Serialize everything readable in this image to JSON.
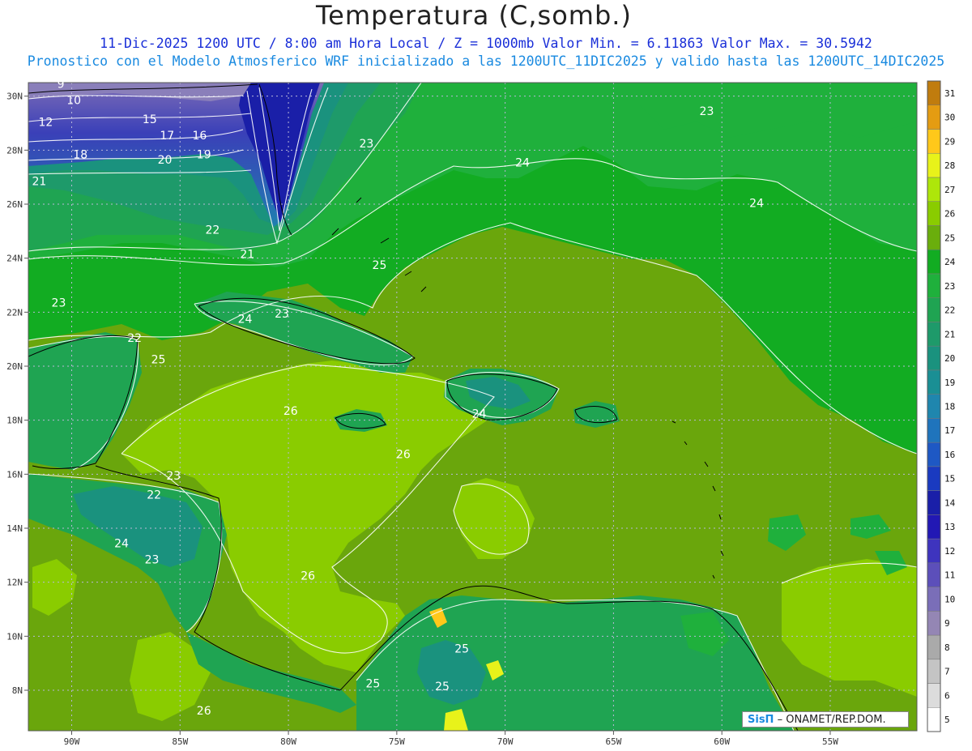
{
  "header": {
    "title": "Temperatura (C,somb.)",
    "line1": "11-Dic-2025  1200 UTC / 8:00 am Hora Local / Z = 1000mb   Valor Min. = 6.11863  Valor Max. = 30.5942",
    "line2": "Pronostico con el Modelo Atmosferico WRF inicializado a las 1200UTC_11DIC2025 y valido hasta las  1200UTC_14DIC2025"
  },
  "map": {
    "lon_range": [
      -92,
      -51
    ],
    "lat_range": [
      6.5,
      30.5
    ],
    "lon_ticks": [
      -90,
      -85,
      -80,
      -75,
      -70,
      -65,
      -60,
      -55
    ],
    "lon_tick_labels": [
      "90W",
      "85W",
      "80W",
      "75W",
      "70W",
      "65W",
      "60W",
      "55W"
    ],
    "lat_ticks": [
      8,
      10,
      12,
      14,
      16,
      18,
      20,
      22,
      24,
      26,
      28,
      30
    ],
    "lat_tick_labels": [
      "8N",
      "10N",
      "12N",
      "14N",
      "16N",
      "18N",
      "20N",
      "22N",
      "24N",
      "26N",
      "28N",
      "30N"
    ],
    "grid": true,
    "contour_labels": [
      {
        "v": "9",
        "lon": -90.5,
        "lat": 30.3
      },
      {
        "v": "10",
        "lon": -89.9,
        "lat": 29.7
      },
      {
        "v": "12",
        "lon": -91.2,
        "lat": 28.9
      },
      {
        "v": "15",
        "lon": -86.4,
        "lat": 29.0
      },
      {
        "v": "17",
        "lon": -85.6,
        "lat": 28.4
      },
      {
        "v": "16",
        "lon": -84.1,
        "lat": 28.4
      },
      {
        "v": "18",
        "lon": -89.6,
        "lat": 27.7
      },
      {
        "v": "20",
        "lon": -85.7,
        "lat": 27.5
      },
      {
        "v": "19",
        "lon": -83.9,
        "lat": 27.7
      },
      {
        "v": "21",
        "lon": -91.5,
        "lat": 26.7
      },
      {
        "v": "22",
        "lon": -83.5,
        "lat": 24.9
      },
      {
        "v": "21",
        "lon": -81.9,
        "lat": 24.0
      },
      {
        "v": "23",
        "lon": -76.4,
        "lat": 28.1
      },
      {
        "v": "24",
        "lon": -69.2,
        "lat": 27.4
      },
      {
        "v": "23",
        "lon": -60.7,
        "lat": 29.3
      },
      {
        "v": "24",
        "lon": -58.4,
        "lat": 25.9
      },
      {
        "v": "25",
        "lon": -75.8,
        "lat": 23.6
      },
      {
        "v": "23",
        "lon": -90.6,
        "lat": 22.2
      },
      {
        "v": "24",
        "lon": -82.0,
        "lat": 21.6
      },
      {
        "v": "23",
        "lon": -80.3,
        "lat": 21.8
      },
      {
        "v": "22",
        "lon": -87.1,
        "lat": 20.9
      },
      {
        "v": "25",
        "lon": -86.0,
        "lat": 20.1
      },
      {
        "v": "26",
        "lon": -79.9,
        "lat": 18.2
      },
      {
        "v": "24",
        "lon": -71.2,
        "lat": 18.1
      },
      {
        "v": "26",
        "lon": -74.7,
        "lat": 16.6
      },
      {
        "v": "23",
        "lon": -85.3,
        "lat": 15.8
      },
      {
        "v": "22",
        "lon": -86.2,
        "lat": 15.1
      },
      {
        "v": "24",
        "lon": -87.7,
        "lat": 13.3
      },
      {
        "v": "23",
        "lon": -86.3,
        "lat": 12.7
      },
      {
        "v": "26",
        "lon": -79.1,
        "lat": 12.1
      },
      {
        "v": "25",
        "lon": -72.0,
        "lat": 9.4
      },
      {
        "v": "25",
        "lon": -76.1,
        "lat": 8.1
      },
      {
        "v": "25",
        "lon": -72.9,
        "lat": 8.0
      },
      {
        "v": "26",
        "lon": -83.9,
        "lat": 7.1
      }
    ]
  },
  "colorbar": {
    "levels": [
      "5",
      "6",
      "7",
      "8",
      "9",
      "10",
      "11",
      "12",
      "13",
      "14",
      "15",
      "16",
      "17",
      "18",
      "19",
      "20",
      "21",
      "22",
      "23",
      "24",
      "25",
      "26",
      "27",
      "28",
      "29",
      "30",
      "31"
    ],
    "colors": [
      "#ffffff",
      "#dcdcdc",
      "#c4c4c4",
      "#aaaaaa",
      "#9486b4",
      "#7a6eb8",
      "#5c4fba",
      "#3e34be",
      "#2218b4",
      "#1a1fa8",
      "#1a3ac0",
      "#1e58c4",
      "#1f74bc",
      "#1f86ae",
      "#1a8f94",
      "#1a927e",
      "#1e9a6a",
      "#1fa452",
      "#1fb03c",
      "#12ac22",
      "#6aae0c",
      "#8acc00",
      "#aee60a",
      "#e8f21a",
      "#ffc81a",
      "#e49c12",
      "#c07c0e"
    ]
  },
  "credit": {
    "logo": "SisΠ",
    "org": "– ONAMET/REP.DOM."
  }
}
